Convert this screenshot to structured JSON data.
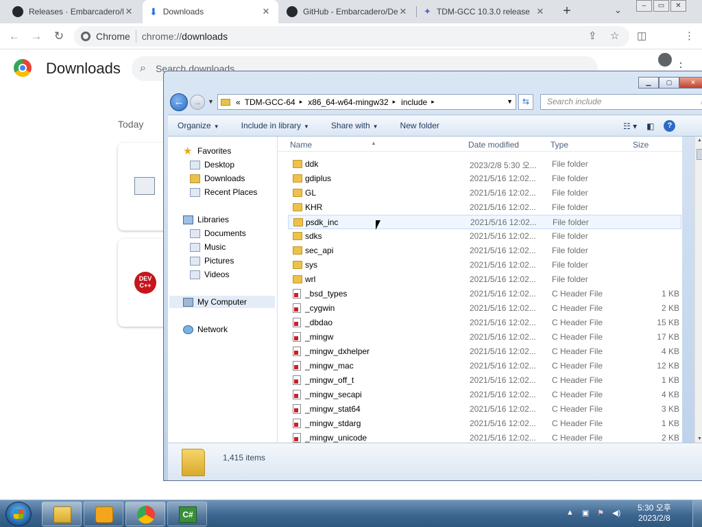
{
  "browser": {
    "tabs": [
      {
        "title": "Releases · Embarcadero/Dev-Cpp",
        "icon": "github-icon"
      },
      {
        "title": "Downloads",
        "icon": "download-icon",
        "active": true
      },
      {
        "title": "GitHub - Embarcadero/Dev-Cpp",
        "icon": "github-icon"
      },
      {
        "title": "TDM-GCC 10.3.0 release",
        "icon": "tdm-icon"
      }
    ],
    "new_tab": "+",
    "omnibox": {
      "site_label": "Chrome",
      "url_scheme": "chrome://",
      "url_path": "downloads"
    }
  },
  "downloads_page": {
    "title": "Downloads",
    "search_placeholder": "Search downloads",
    "section": "Today",
    "item_icons": [
      "installer-icon",
      "devcpp-icon"
    ],
    "devcpp_badge": "DEV C++"
  },
  "explorer": {
    "breadcrumbs": [
      "«",
      "TDM-GCC-64",
      "x86_64-w64-mingw32",
      "include"
    ],
    "search_placeholder": "Search include",
    "commands": [
      "Organize",
      "Include in library",
      "Share with",
      "New folder"
    ],
    "nav": {
      "favorites": "Favorites",
      "favorites_items": [
        "Desktop",
        "Downloads",
        "Recent Places"
      ],
      "libraries": "Libraries",
      "libraries_items": [
        "Documents",
        "Music",
        "Pictures",
        "Videos"
      ],
      "computer": "My Computer",
      "network": "Network"
    },
    "columns": {
      "name": "Name",
      "date": "Date modified",
      "type": "Type",
      "size": "Size"
    },
    "files": [
      {
        "name": "ddk",
        "date": "2023/2/8 5:30 오...",
        "type": "File folder",
        "size": "",
        "kind": "folder"
      },
      {
        "name": "gdiplus",
        "date": "2021/5/16 12:02...",
        "type": "File folder",
        "size": "",
        "kind": "folder"
      },
      {
        "name": "GL",
        "date": "2021/5/16 12:02...",
        "type": "File folder",
        "size": "",
        "kind": "folder"
      },
      {
        "name": "KHR",
        "date": "2021/5/16 12:02...",
        "type": "File folder",
        "size": "",
        "kind": "folder"
      },
      {
        "name": "psdk_inc",
        "date": "2021/5/16 12:02...",
        "type": "File folder",
        "size": "",
        "kind": "folder",
        "hover": true
      },
      {
        "name": "sdks",
        "date": "2021/5/16 12:02...",
        "type": "File folder",
        "size": "",
        "kind": "folder"
      },
      {
        "name": "sec_api",
        "date": "2021/5/16 12:02...",
        "type": "File folder",
        "size": "",
        "kind": "folder"
      },
      {
        "name": "sys",
        "date": "2021/5/16 12:02...",
        "type": "File folder",
        "size": "",
        "kind": "folder"
      },
      {
        "name": "wrl",
        "date": "2021/5/16 12:02...",
        "type": "File folder",
        "size": "",
        "kind": "folder"
      },
      {
        "name": "_bsd_types",
        "date": "2021/5/16 12:02...",
        "type": "C Header File",
        "size": "1 KB",
        "kind": "hfile"
      },
      {
        "name": "_cygwin",
        "date": "2021/5/16 12:02...",
        "type": "C Header File",
        "size": "2 KB",
        "kind": "hfile"
      },
      {
        "name": "_dbdao",
        "date": "2021/5/16 12:02...",
        "type": "C Header File",
        "size": "15 KB",
        "kind": "hfile"
      },
      {
        "name": "_mingw",
        "date": "2021/5/16 12:02...",
        "type": "C Header File",
        "size": "17 KB",
        "kind": "hfile"
      },
      {
        "name": "_mingw_dxhelper",
        "date": "2021/5/16 12:02...",
        "type": "C Header File",
        "size": "4 KB",
        "kind": "hfile"
      },
      {
        "name": "_mingw_mac",
        "date": "2021/5/16 12:02...",
        "type": "C Header File",
        "size": "12 KB",
        "kind": "hfile"
      },
      {
        "name": "_mingw_off_t",
        "date": "2021/5/16 12:02...",
        "type": "C Header File",
        "size": "1 KB",
        "kind": "hfile"
      },
      {
        "name": "_mingw_secapi",
        "date": "2021/5/16 12:02...",
        "type": "C Header File",
        "size": "4 KB",
        "kind": "hfile"
      },
      {
        "name": "_mingw_stat64",
        "date": "2021/5/16 12:02...",
        "type": "C Header File",
        "size": "3 KB",
        "kind": "hfile"
      },
      {
        "name": "_mingw_stdarg",
        "date": "2021/5/16 12:02...",
        "type": "C Header File",
        "size": "1 KB",
        "kind": "hfile"
      },
      {
        "name": "_mingw_unicode",
        "date": "2021/5/16 12:02...",
        "type": "C Header File",
        "size": "2 KB",
        "kind": "hfile"
      }
    ],
    "item_count": "1,415 items"
  },
  "taskbar": {
    "apps": [
      "explorer-icon",
      "media-player-icon",
      "chrome-icon",
      "csharp-icon"
    ],
    "clock_time": "5:30 오후",
    "clock_date": "2023/2/8"
  }
}
